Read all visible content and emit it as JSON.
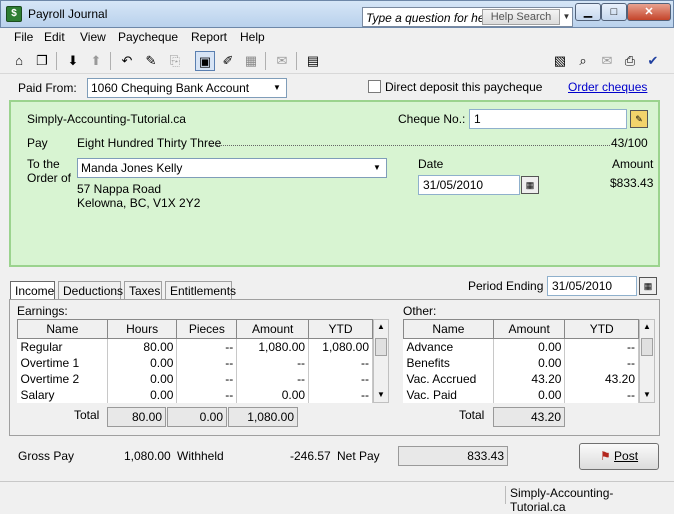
{
  "window": {
    "title": "Payroll Journal"
  },
  "help": {
    "placeholder": "Type a question for help",
    "button": "Help Search"
  },
  "menu": [
    "File",
    "Edit",
    "View",
    "Paycheque",
    "Report",
    "Help"
  ],
  "paid_from": {
    "label": "Paid From:",
    "account": "1060 Chequing Bank Account",
    "direct_deposit_label": "Direct deposit this paycheque",
    "order_cheques": "Order cheques"
  },
  "cheque": {
    "company": "Simply-Accounting-Tutorial.ca",
    "cheque_no_label": "Cheque No.:",
    "cheque_no": "1",
    "pay_label": "Pay",
    "pay_words": "Eight Hundred Thirty Three",
    "pay_cents": "43/100",
    "to_order_label_1": "To the",
    "to_order_label_2": "Order of",
    "payee": "Manda Jones Kelly",
    "address_1": "57 Nappa Road",
    "address_2": "Kelowna, BC, V1X 2Y2",
    "date_label": "Date",
    "date": "31/05/2010",
    "amount_label": "Amount",
    "amount": "$833.43"
  },
  "tabs": [
    "Income",
    "Deductions",
    "Taxes",
    "Entitlements"
  ],
  "period_ending": {
    "label": "Period Ending",
    "value": "31/05/2010"
  },
  "earnings": {
    "label": "Earnings:",
    "columns": [
      "Name",
      "Hours",
      "Pieces",
      "Amount",
      "YTD"
    ],
    "rows": [
      [
        "Regular",
        "80.00",
        "--",
        "1,080.00",
        "1,080.00"
      ],
      [
        "Overtime 1",
        "0.00",
        "--",
        "--",
        "--"
      ],
      [
        "Overtime 2",
        "0.00",
        "--",
        "--",
        "--"
      ],
      [
        "Salary",
        "0.00",
        "--",
        "0.00",
        "--"
      ]
    ],
    "total_label": "Total",
    "totals": [
      "80.00",
      "0.00",
      "1,080.00"
    ]
  },
  "other": {
    "label": "Other:",
    "columns": [
      "Name",
      "Amount",
      "YTD"
    ],
    "rows": [
      [
        "Advance",
        "0.00",
        "--"
      ],
      [
        "Benefits",
        "0.00",
        "--"
      ],
      [
        "Vac. Accrued",
        "43.20",
        "43.20"
      ],
      [
        "Vac. Paid",
        "0.00",
        "--"
      ]
    ],
    "total_label": "Total",
    "total": "43.20"
  },
  "summary": {
    "gross_label": "Gross Pay",
    "gross": "1,080.00",
    "withheld_label": "Withheld",
    "withheld": "-246.57",
    "net_label": "Net Pay",
    "net": "833.43"
  },
  "post_button": "Post",
  "status": "Simply-Accounting-Tutorial.ca"
}
